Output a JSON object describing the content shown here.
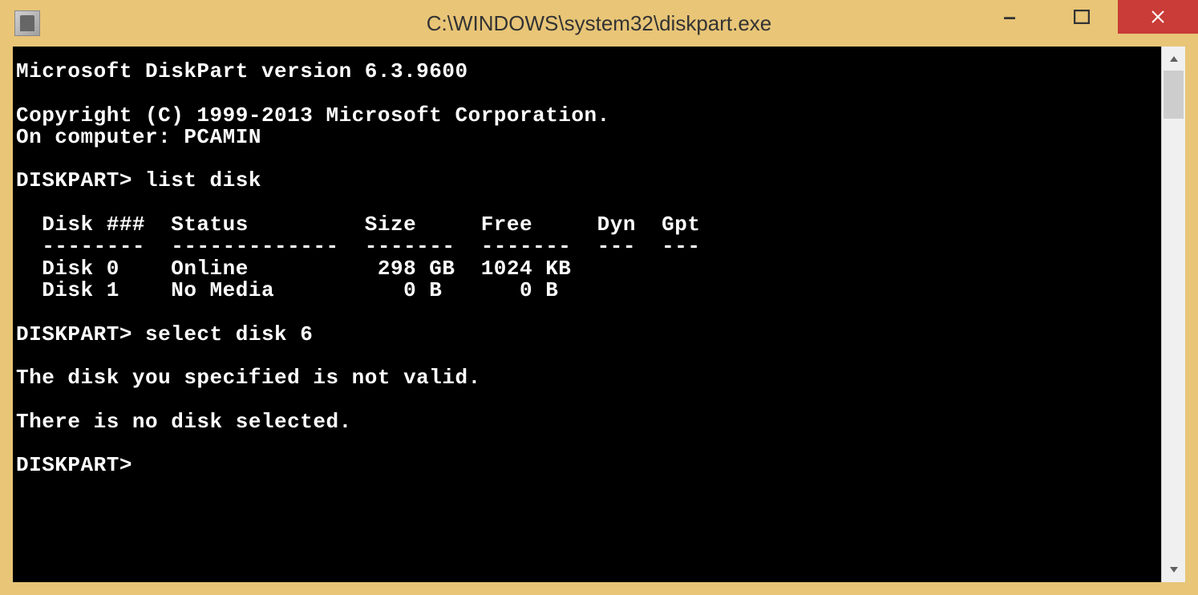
{
  "window": {
    "title": "C:\\WINDOWS\\system32\\diskpart.exe"
  },
  "console": {
    "version_line": "Microsoft DiskPart version 6.3.9600",
    "copyright_line": "Copyright (C) 1999-2013 Microsoft Corporation.",
    "computer_line": "On computer: PCAMIN",
    "prompt1": "DISKPART> list disk",
    "table_header": "  Disk ###  Status         Size     Free     Dyn  Gpt",
    "table_divider": "  --------  -------------  -------  -------  ---  ---",
    "table_row0": "  Disk 0    Online          298 GB  1024 KB",
    "table_row1": "  Disk 1    No Media          0 B      0 B",
    "prompt2": "DISKPART> select disk 6",
    "error_line": "The disk you specified is not valid.",
    "no_disk_line": "There is no disk selected.",
    "prompt3": "DISKPART>"
  }
}
